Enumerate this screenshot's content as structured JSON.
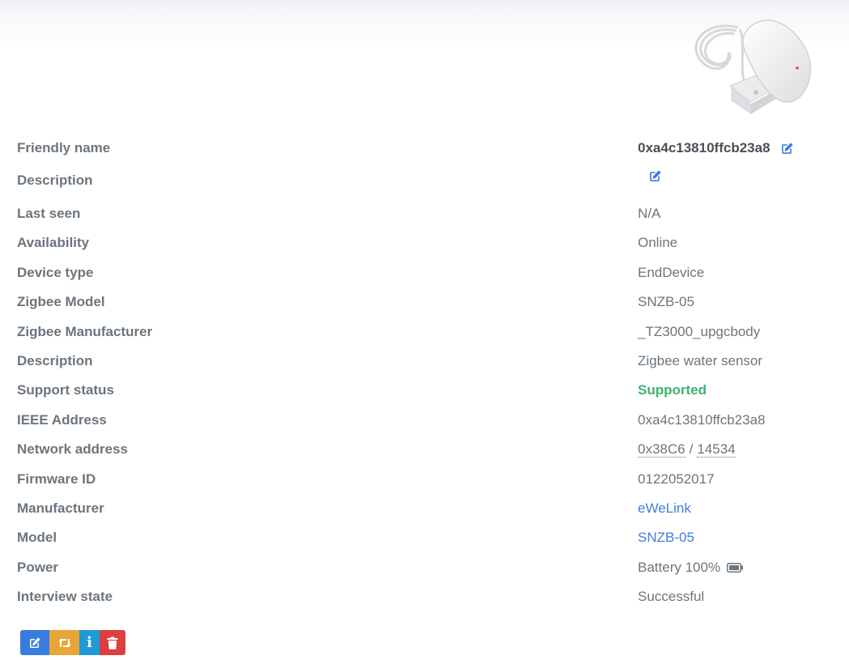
{
  "device": {
    "image_alt": "Zigbee water sensor",
    "fields": [
      {
        "key": "friendly_name",
        "label": "Friendly name",
        "value": "0xa4c13810ffcb23a8"
      },
      {
        "key": "description_editable",
        "label": "Description",
        "value": ""
      },
      {
        "key": "last_seen",
        "label": "Last seen",
        "value": "N/A"
      },
      {
        "key": "availability",
        "label": "Availability",
        "value": "Online"
      },
      {
        "key": "device_type",
        "label": "Device type",
        "value": "EndDevice"
      },
      {
        "key": "zigbee_model",
        "label": "Zigbee Model",
        "value": "SNZB-05"
      },
      {
        "key": "zigbee_manufacturer",
        "label": "Zigbee Manufacturer",
        "value": "_TZ3000_upgcbody"
      },
      {
        "key": "description",
        "label": "Description",
        "value": "Zigbee water sensor"
      },
      {
        "key": "support_status",
        "label": "Support status",
        "value": "Supported"
      },
      {
        "key": "ieee_address",
        "label": "IEEE Address",
        "value": "0xa4c13810ffcb23a8"
      },
      {
        "key": "network_address",
        "label": "Network address",
        "value_hex": "0x38C6",
        "separator": "/",
        "value_dec": "14534"
      },
      {
        "key": "firmware_id",
        "label": "Firmware ID",
        "value": "0122052017"
      },
      {
        "key": "manufacturer",
        "label": "Manufacturer",
        "value": "eWeLink"
      },
      {
        "key": "model",
        "label": "Model",
        "value": "SNZB-05"
      },
      {
        "key": "power",
        "label": "Power",
        "value": "Battery 100%",
        "battery_level": 1.0
      },
      {
        "key": "interview_state",
        "label": "Interview state",
        "value": "Successful"
      }
    ]
  },
  "icons": {
    "edit": "edit-icon",
    "battery": "battery-full-icon",
    "rename": "pencil-square-icon",
    "reconfigure": "retweet-icon",
    "interview": "info-icon",
    "remove": "trash-icon"
  },
  "colors": {
    "link": "#3f7fd8",
    "success": "#3cb371",
    "btn_edit": "#3a7be0",
    "btn_reconfigure": "#e8a637",
    "btn_interview": "#1e9bd7",
    "btn_remove": "#dc3f3f"
  }
}
